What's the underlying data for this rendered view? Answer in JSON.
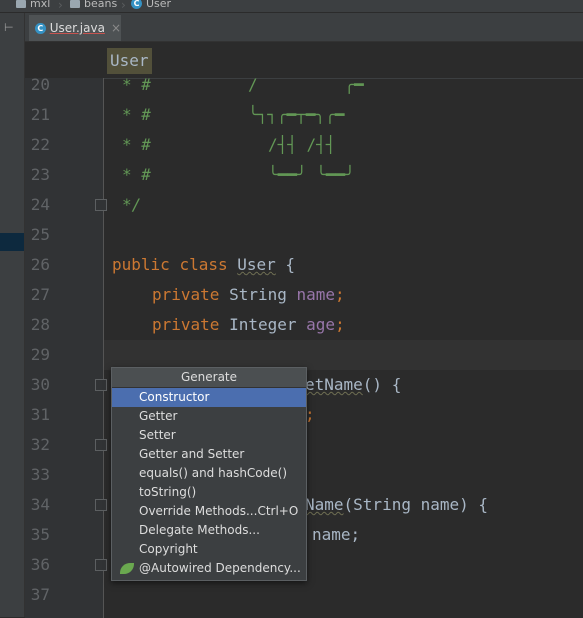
{
  "breadcrumb": {
    "items": [
      {
        "label": "mxl",
        "icon": "folder-icon"
      },
      {
        "label": "beans",
        "icon": "folder-icon"
      },
      {
        "label": "User",
        "icon": "class-icon"
      }
    ]
  },
  "tab": {
    "label": "User.java",
    "icon_letter": "C",
    "close": "×"
  },
  "sticky": {
    "label": "User"
  },
  "editor": {
    "lines": [
      {
        "num": "20",
        "comment": "* #",
        "art": "/         ╭━"
      },
      {
        "num": "21",
        "comment": "* #",
        "art": "╰┐┐╭━┬━╮╭━"
      },
      {
        "num": "22",
        "comment": "* #",
        "art": "/┤┤ /┤┤"
      },
      {
        "num": "23",
        "comment": "* #",
        "art": "╰━━╯ ╰━━╯"
      },
      {
        "num": "24",
        "comment": "*/"
      },
      {
        "num": "25"
      },
      {
        "num": "26",
        "kw1": "public",
        "kw2": "class",
        "name": "User",
        "rest": " {"
      },
      {
        "num": "27",
        "kw1": "private",
        "type": "String",
        "field": "name",
        "end": ";"
      },
      {
        "num": "28",
        "kw1": "private",
        "type": "Integer",
        "field": "age",
        "end": ";"
      },
      {
        "num": "29"
      },
      {
        "num": "30",
        "tail_name": "etName",
        "tail_rest": "() {"
      },
      {
        "num": "31",
        "tail": ";"
      },
      {
        "num": "32"
      },
      {
        "num": "33"
      },
      {
        "num": "34",
        "tail_name": "Name",
        "tail_rest": "(String name) {"
      },
      {
        "num": "35",
        "tail": "name;"
      },
      {
        "num": "36"
      },
      {
        "num": "37"
      }
    ]
  },
  "popup": {
    "title": "Generate",
    "items": [
      {
        "label": "Constructor",
        "shortcut": "",
        "selected": true
      },
      {
        "label": "Getter",
        "shortcut": ""
      },
      {
        "label": "Setter",
        "shortcut": ""
      },
      {
        "label": "Getter and Setter",
        "shortcut": ""
      },
      {
        "label": "equals() and hashCode()",
        "shortcut": ""
      },
      {
        "label": "toString()",
        "shortcut": ""
      },
      {
        "label": "Override Methods...",
        "shortcut": "Ctrl+O"
      },
      {
        "label": "Delegate Methods...",
        "shortcut": ""
      },
      {
        "label": "Copyright",
        "shortcut": ""
      },
      {
        "label": "@Autowired Dependency...",
        "shortcut": "",
        "icon": "spring-leaf-icon"
      }
    ]
  },
  "colors": {
    "accent": "#4b6eaf",
    "keyword": "#cc7832",
    "field": "#9876aa",
    "comment": "#629755",
    "background": "#2b2b2b"
  }
}
